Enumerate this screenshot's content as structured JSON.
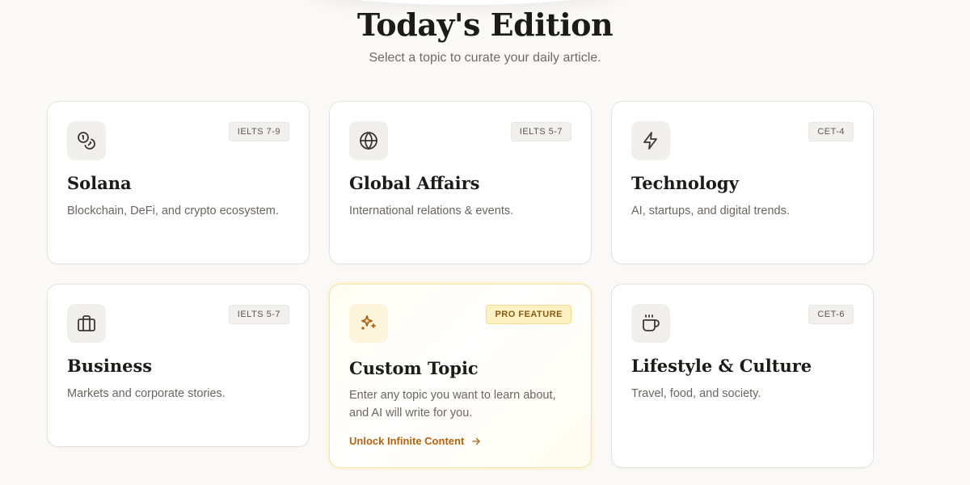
{
  "header": {
    "title": "Today's Edition",
    "subtitle": "Select a topic to curate your daily article."
  },
  "topics": [
    {
      "icon": "coins-icon",
      "badge": "IELTS 7-9",
      "title": "Solana",
      "description": "Blockchain, DeFi, and crypto ecosystem."
    },
    {
      "icon": "globe-icon",
      "badge": "IELTS 5-7",
      "title": "Global Affairs",
      "description": "International relations & events."
    },
    {
      "icon": "lightning-icon",
      "badge": "CET-4",
      "title": "Technology",
      "description": "AI, startups, and digital trends."
    },
    {
      "icon": "briefcase-icon",
      "badge": "IELTS 5-7",
      "title": "Business",
      "description": "Markets and corporate stories."
    },
    {
      "icon": "sparkles-icon",
      "badge": "PRO FEATURE",
      "title": "Custom Topic",
      "description": "Enter any topic you want to learn about, and AI will write for you.",
      "cta": "Unlock Infinite Content"
    },
    {
      "icon": "coffee-cup-icon",
      "badge": "CET-6",
      "title": "Lifestyle & Culture",
      "description": "Travel, food, and society."
    }
  ],
  "colors": {
    "background": "#faf9f7",
    "pro_accent": "#b4620e",
    "pro_badge_bg": "#fdf1c4"
  }
}
